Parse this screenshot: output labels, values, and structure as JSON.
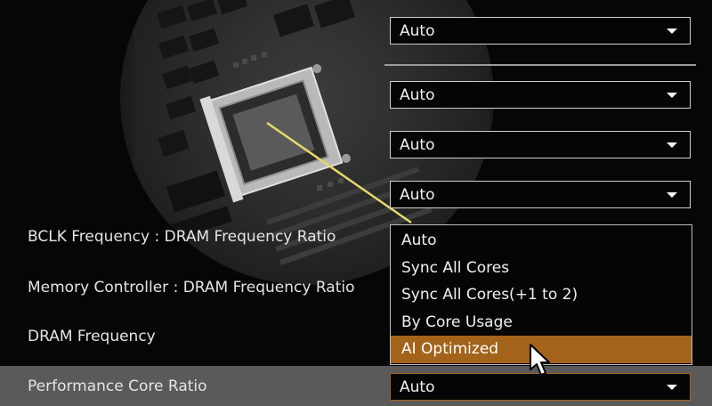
{
  "dropdowns": {
    "top1": "Auto",
    "top2": "Auto",
    "top3": "Auto",
    "top4": "Auto",
    "performance_core_ratio": "Auto"
  },
  "labels": {
    "bclk": "BCLK Frequency : DRAM Frequency Ratio",
    "memctrl": "Memory Controller : DRAM Frequency Ratio",
    "dram": "DRAM Frequency",
    "pcore": "Performance Core Ratio"
  },
  "open_dropdown": {
    "options": [
      "Auto",
      "Sync All Cores",
      "Sync All Cores(+1 to 2)",
      "By Core Usage",
      "AI Optimized"
    ],
    "selected": "AI Optimized"
  },
  "colors": {
    "selected_option": "#a3631a",
    "row_highlight": "#5a5a5a",
    "pointer_line": "#e6d96a"
  }
}
